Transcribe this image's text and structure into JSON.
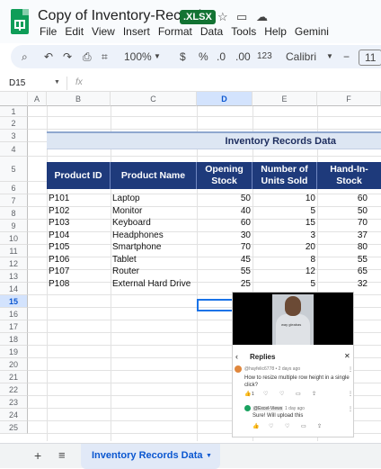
{
  "app": {
    "title": "Copy of Inventory-Record",
    "badge": ".XLSX",
    "menu": [
      "File",
      "Edit",
      "View",
      "Insert",
      "Format",
      "Data",
      "Tools",
      "Help",
      "Gemini"
    ]
  },
  "toolbar": {
    "zoom": "100%",
    "currency": "$",
    "percent": "%",
    "dec_decrease": ".0",
    "dec_increase": ".00",
    "number_format": "123",
    "font": "Calibri",
    "font_size": "11"
  },
  "formula_bar": {
    "cell_ref": "D15",
    "fx": "fx",
    "value": ""
  },
  "columns": [
    "A",
    "B",
    "C",
    "D",
    "E",
    "F"
  ],
  "rows": [
    "1",
    "2",
    "3",
    "4",
    "5",
    "6",
    "7",
    "8",
    "9",
    "10",
    "11",
    "12",
    "13",
    "14",
    "15",
    "16",
    "17",
    "18",
    "19",
    "20",
    "21",
    "22",
    "23",
    "24",
    "25"
  ],
  "sheet": {
    "banner": "Inventory Records Data",
    "headers": [
      "Product ID",
      "Product Name",
      "Opening Stock",
      "Number of Units Sold",
      "Hand-In-Stock"
    ],
    "data": [
      [
        "P101",
        "Laptop",
        "50",
        "10",
        "60"
      ],
      [
        "P102",
        "Monitor",
        "40",
        "5",
        "50"
      ],
      [
        "P103",
        "Keyboard",
        "60",
        "15",
        "70"
      ],
      [
        "P104",
        "Headphones",
        "30",
        "3",
        "37"
      ],
      [
        "P105",
        "Smartphone",
        "70",
        "20",
        "80"
      ],
      [
        "P106",
        "Tablet",
        "45",
        "8",
        "55"
      ],
      [
        "P107",
        "Router",
        "55",
        "12",
        "65"
      ],
      [
        "P108",
        "External Hard Drive",
        "25",
        "5",
        "32"
      ]
    ]
  },
  "video": {
    "caption": "way gleabas",
    "replies_title": "Replies",
    "comment_user": "@hayfelic6778 • 2 days ago",
    "comment_text_1": "How to resize multiple  row height in a single",
    "comment_text_2": "click?",
    "comment_likes": "1",
    "reply_user": "@Excel-Views",
    "reply_time": "1 day ago",
    "reply_text": "Sure! Will upload this"
  },
  "bottom": {
    "add": "+",
    "menu": "≡",
    "tab": "Inventory Records Data"
  },
  "colors": {
    "header_fill": "#1e3a7b",
    "banner_fill": "#dde6f3",
    "badge": "#137333",
    "tab": "#0b57d0"
  }
}
